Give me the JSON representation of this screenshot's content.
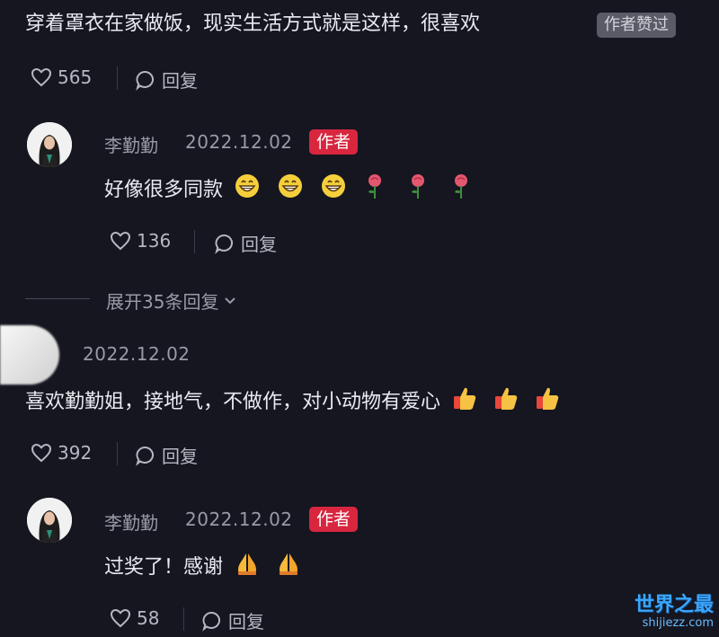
{
  "comments": [
    {
      "text": "穿着罩衣在家做饭，现实生活方式就是这样，很喜欢",
      "author_liked_label": "作者赞过",
      "likes": "565",
      "reply_label": "回复"
    },
    {
      "name": "李勤勤",
      "date": "2022.12.02",
      "author_badge": "作者",
      "text": "好像很多同款",
      "emoji": [
        "grin-emoji",
        "grin-emoji",
        "grin-emoji",
        "rose-emoji",
        "rose-emoji",
        "rose-emoji"
      ],
      "likes": "136",
      "reply_label": "回复"
    },
    {
      "expand_label": "展开35条回复"
    },
    {
      "date": "2022.12.02",
      "text": "喜欢勤勤姐，接地气，不做作，对小动物有爱心",
      "emoji": [
        "thumbs-up-emoji",
        "thumbs-up-emoji",
        "thumbs-up-emoji"
      ],
      "likes": "392",
      "reply_label": "回复"
    },
    {
      "name": "李勤勤",
      "date": "2022.12.02",
      "author_badge": "作者",
      "text": "过奖了！感谢",
      "emoji": [
        "pray-emoji",
        "pray-emoji"
      ],
      "likes": "58",
      "reply_label": "回复"
    }
  ],
  "watermark": {
    "line1": "世界之最",
    "line2": "shijiezz.com"
  },
  "colors": {
    "background": "#151620",
    "author_badge": "#d9263f",
    "muted_text": "#9a9aa6"
  }
}
